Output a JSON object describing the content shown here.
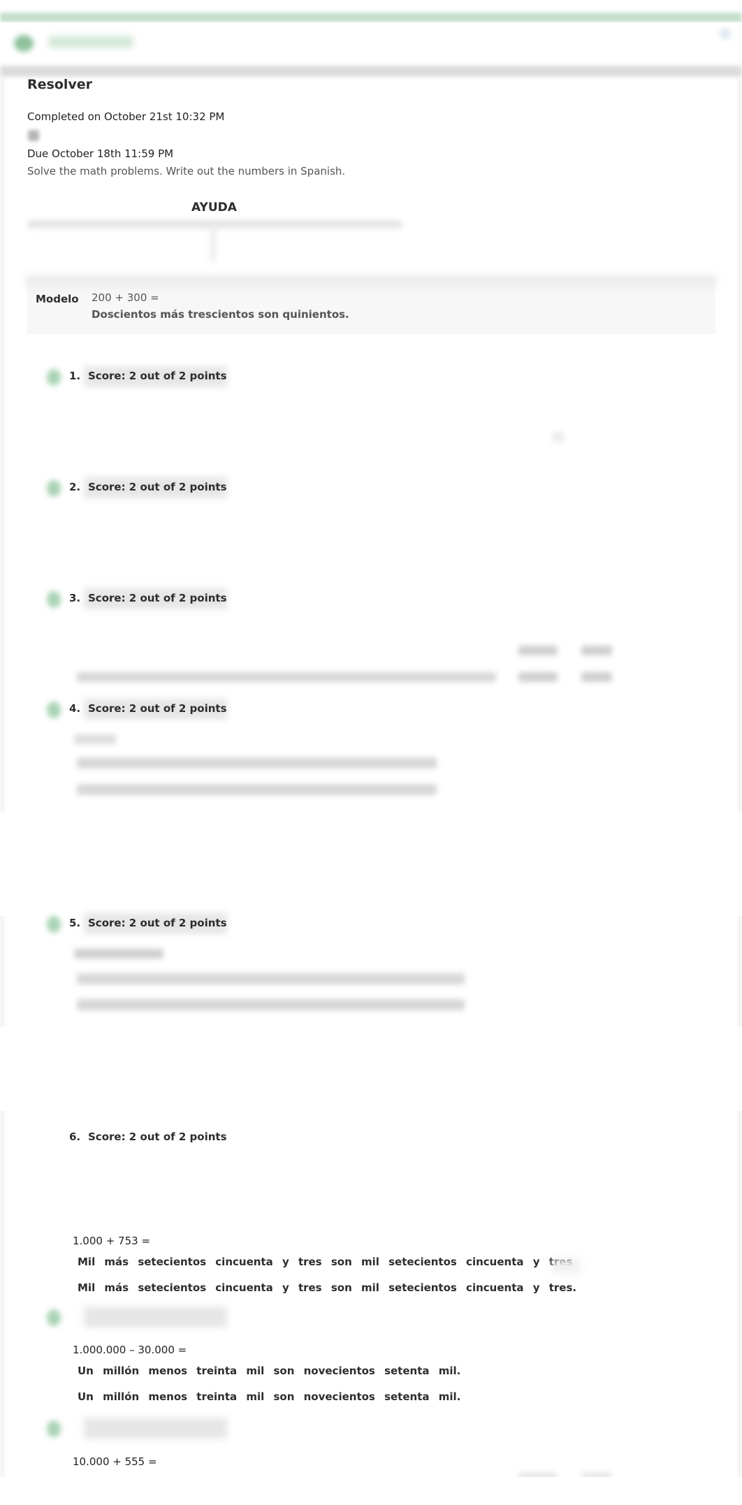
{
  "header": {
    "brand_icon": "leaf-logo-icon",
    "brand_text": "",
    "right_icon": "user-icon"
  },
  "assignment": {
    "title": "Resolver",
    "completed": "Completed on October 21st 10:32 PM",
    "status_icon": "status-icon",
    "due": "Due October 18th 11:59 PM",
    "instructions": "Solve the math problems. Write out the numbers in Spanish."
  },
  "help": {
    "label": "AYUDA"
  },
  "model": {
    "label": "Modelo",
    "equation": "200 + 300 =",
    "answer": "Doscientos más trescientos son quinientos."
  },
  "questions": [
    {
      "number": "1.",
      "score": "Score: 2 out of 2 points",
      "status_icon": "check-icon"
    },
    {
      "number": "2.",
      "score": "Score: 2 out of 2 points",
      "status_icon": "check-icon"
    },
    {
      "number": "3.",
      "score": "Score: 2 out of 2 points",
      "status_icon": "check-icon"
    },
    {
      "number": "4.",
      "score": "Score: 2 out of 2 points",
      "status_icon": "check-icon"
    },
    {
      "number": "5.",
      "score": "Score: 2 out of 2 points",
      "status_icon": "check-icon"
    },
    {
      "number": "6.",
      "score": "Score: 2 out of 2 points",
      "status_icon": "check-icon"
    }
  ],
  "items": [
    {
      "equation": "1.000 + 753 =",
      "student_answer": "Mil más setecientos cincuenta y tres son mil setecientos cincuenta y tres",
      "correct_answer": "Mil más setecientos cincuenta y tres son mil setecientos cincuenta y tres."
    },
    {
      "equation": "1.000.000 – 30.000 =",
      "student_answer": "Un millón menos treinta mil son novecientos setenta mil.",
      "correct_answer": "Un millón menos treinta mil son novecientos setenta mil."
    },
    {
      "equation": "10.000 + 555 ="
    }
  ],
  "colors": {
    "accent_green": "#a9d3b4",
    "header_green": "#c5dfcb",
    "text_dark": "#2d2d2d",
    "text_muted": "#555555"
  }
}
